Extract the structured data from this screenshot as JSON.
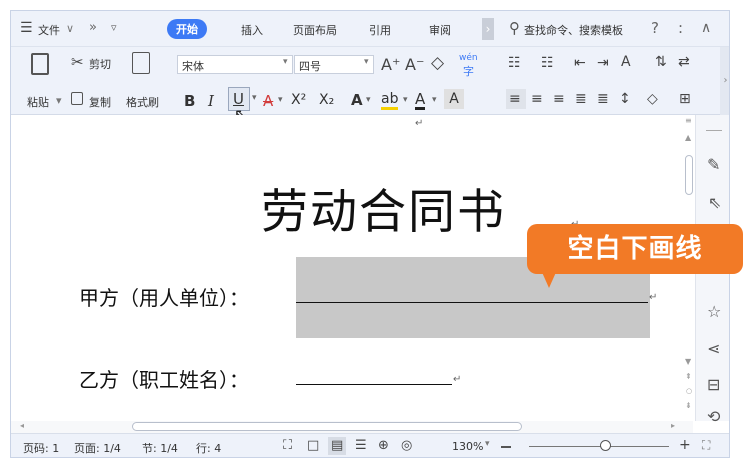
{
  "menu": {
    "file_label": "文件",
    "file_arrow": "∨",
    "more": "»",
    "quick_arrow": "▿"
  },
  "tabs": [
    "开始",
    "插入",
    "页面布局",
    "引用",
    "审阅"
  ],
  "tab_scroll": "›",
  "search": {
    "placeholder": "查找命令、搜索模板"
  },
  "top_right": {
    "help": "?",
    "more": ":",
    "collapse": "∧"
  },
  "clipboard": {
    "paste": "粘贴",
    "cut": "剪切",
    "copy": "复制",
    "format_painter": "格式刷"
  },
  "font": {
    "name": "宋体",
    "size": "四号",
    "grow": "A⁺",
    "shrink": "A⁻",
    "clear": "◇",
    "phonetic": "wén",
    "bold": "B",
    "italic": "I",
    "underline": "U",
    "strike": "A",
    "superscript": "X²",
    "subscript": "X₂",
    "effects": "A",
    "highlight": "ab",
    "color": "A",
    "char_shade": "A"
  },
  "document": {
    "return_mark": "↵",
    "title": "劳动合同书",
    "party_a_label": "甲方（用人单位）：",
    "party_b_label": "乙方（职工姓名）："
  },
  "callout": {
    "text": "空白下画线"
  },
  "status": {
    "page_no": "页码: 1",
    "page": "页面: 1/4",
    "section": "节: 1/4",
    "row": "行: 4",
    "zoom": "130%",
    "zoom_level": 0.55
  },
  "colors": {
    "accent": "#3d7af5",
    "callout": "#f27a26",
    "highlight_block": "#c8c8c8"
  }
}
